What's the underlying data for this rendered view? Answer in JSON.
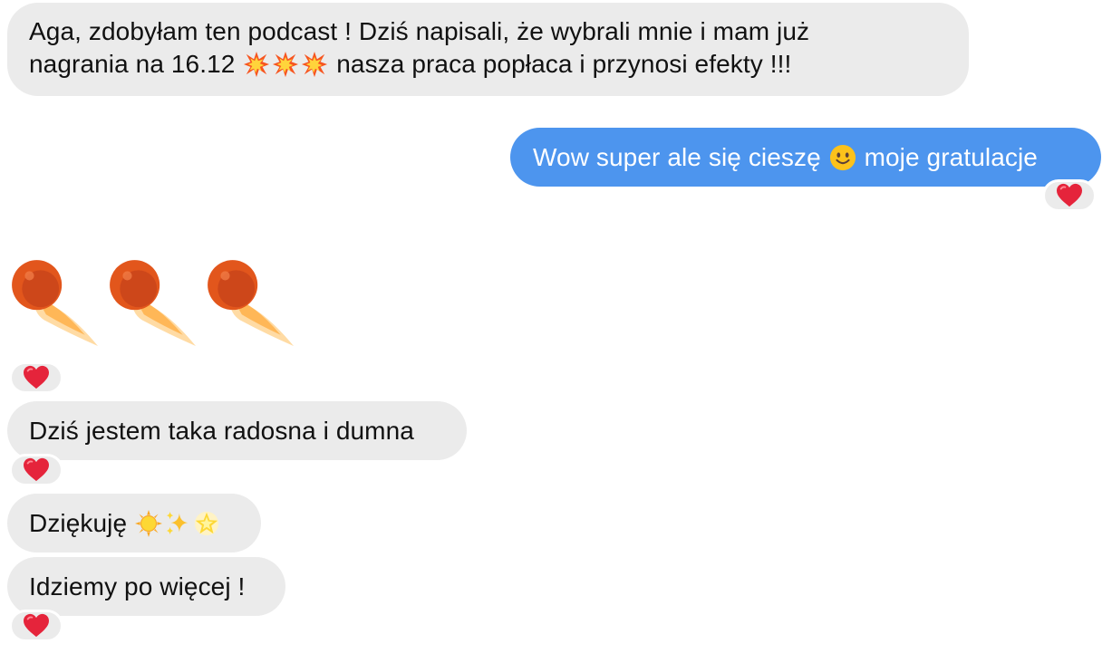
{
  "messages": [
    {
      "id": "m1",
      "direction": "incoming",
      "line1": "Aga, zdobyłam ten podcast ! Dziś napisali, że wybrali mnie i mam już",
      "line2_before": "nagrania na 16.12",
      "line2_emojis": [
        "collision",
        "collision",
        "collision"
      ],
      "line2_after": "nasza praca popłaca i przynosi efekty !!!"
    },
    {
      "id": "m2",
      "direction": "outgoing",
      "text_before": "Wow super ale się cieszę",
      "emoji": "slightly-smiling-face",
      "text_after": "moje gratulacje",
      "reaction": "red-heart"
    },
    {
      "id": "m3",
      "direction": "incoming",
      "big_emojis": [
        "comet",
        "comet",
        "comet"
      ],
      "reaction": "red-heart"
    },
    {
      "id": "m4",
      "direction": "incoming",
      "text": "Dziś jestem taka radosna i dumna",
      "reaction": "red-heart"
    },
    {
      "id": "m5",
      "direction": "incoming",
      "text": "Dziękuję",
      "emojis": [
        "sun",
        "sparkles",
        "glowing-star"
      ]
    },
    {
      "id": "m6",
      "direction": "incoming",
      "text": "Idziemy po więcej !",
      "reaction": "red-heart"
    }
  ],
  "colors": {
    "incoming_bubble": "#ebebeb",
    "outgoing_bubble": "#4d95ee",
    "incoming_text": "#111111",
    "outgoing_text": "#ffffff",
    "heart": "#e5243b"
  }
}
